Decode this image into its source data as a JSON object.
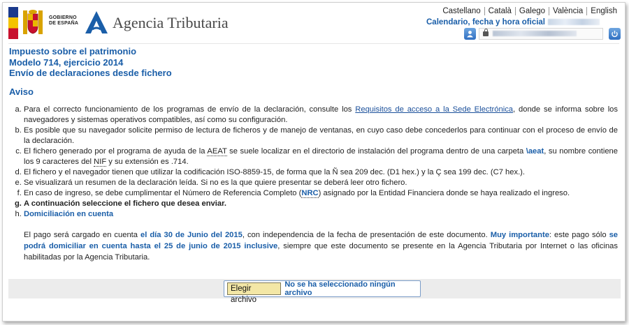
{
  "header": {
    "gov_line1": "GOBIERNO",
    "gov_line2": "DE ESPAÑA",
    "agency_name": "Agencia Tributaria",
    "languages": [
      "Castellano",
      "Català",
      "Galego",
      "València",
      "English"
    ],
    "calendar_label": "Calendario, fecha y hora oficial"
  },
  "titles": {
    "line1": "Impuesto sobre el patrimonio",
    "line2": "Modelo 714, ejercicio 2014",
    "line3": "Envío de declaraciones desde fichero"
  },
  "aviso": "Aviso",
  "notes": {
    "a_pre": "Para el correcto funcionamiento de los programas de envío de la declaración, consulte los ",
    "a_link": "Requisitos de acceso a la Sede Electrónica",
    "a_post": ", donde se informa sobre los navegadores y sistemas operativos compatibles, así como su configuración.",
    "b": "Es posible que su navegador solicite permiso de lectura de ficheros y de manejo de ventanas, en cuyo caso debe concederlos para continuar con el proceso de envío de la declaración.",
    "c_pre": "El fichero generado por el programa de ayuda de la ",
    "c_abbr1": "AEAT",
    "c_mid": " se suele localizar en el directorio de instalación del programa dentro de una carpeta ",
    "c_folder": "\\aeat",
    "c_mid2": ", su nombre contiene los 9 caracteres del ",
    "c_abbr2": "NIF",
    "c_post": " y su extensión es .714.",
    "d": "El fichero y el navegador tienen que utilizar la codificación ISO-8859-15, de forma que la Ñ sea 209 dec. (D1 hex.) y la Ç sea 199 dec. (C7 hex.).",
    "e": "Se visualizará un resumen de la declaración leída. Si no es la que quiere presentar se deberá leer otro fichero.",
    "f_pre": "En caso de ingreso, se debe cumplimentar el Número de Referencia Completo (",
    "f_abbr": "NRC",
    "f_post": ") asignado por la Entidad Financiera donde se haya realizado el ingreso.",
    "g": "A continuación seleccione el fichero que desea enviar.",
    "h_title": "Domiciliación en cuenta",
    "h_p1": "El pago será cargado en cuenta ",
    "h_b1": "el día 30 de Junio del 2015",
    "h_p2": ", con independencia de la fecha de presentación de este documento. ",
    "h_b2": "Muy importante",
    "h_p3": ": este pago sólo ",
    "h_b3": "se podrá domiciliar en cuenta hasta el 25 de junio de 2015 inclusive",
    "h_p4": ", siempre que este documento se presente en la Agencia Tributaria por Internet o las oficinas habilitadas por la Agencia Tributaria."
  },
  "file": {
    "button_label": "Elegir archivo",
    "status": "No se ha seleccionado ningún archivo"
  },
  "colors": {
    "accent": "#1a5ea8",
    "button": "#f3e7a6"
  }
}
